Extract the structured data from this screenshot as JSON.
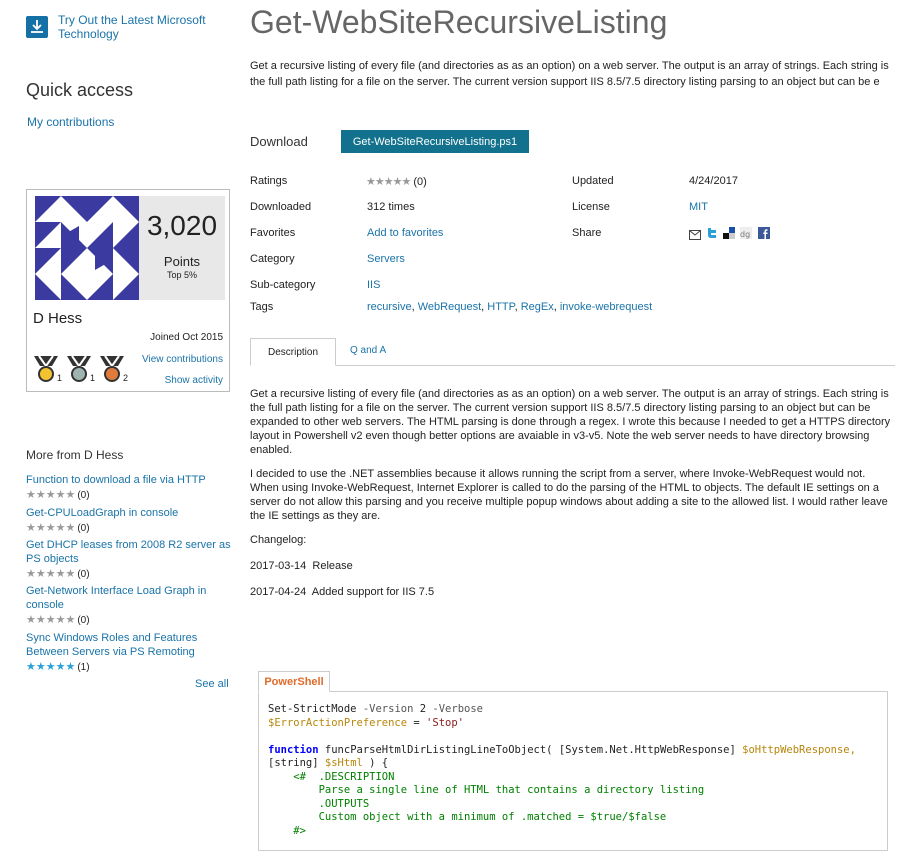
{
  "sidebar": {
    "promo_text": "Try Out the Latest Microsoft Technology",
    "quick_access_title": "Quick access",
    "my_contributions": "My contributions",
    "profile": {
      "points": "3,020",
      "points_label": "Points",
      "rank": "Top 5%",
      "name": "D Hess",
      "joined": "Joined Oct 2015",
      "view_contributions": "View contributions",
      "show_activity": "Show activity",
      "medals": [
        {
          "color": "gold",
          "count": "1"
        },
        {
          "color": "silver",
          "count": "1"
        },
        {
          "color": "bronze",
          "count": "2"
        }
      ]
    },
    "more_title": "More from D Hess",
    "more_items": [
      {
        "title": "Function to download a file via HTTP",
        "stars": "★★★★★",
        "count": "(0)"
      },
      {
        "title": "Get-CPULoadGraph in console",
        "stars": "★★★★★",
        "count": "(0)"
      },
      {
        "title": "Get DHCP leases from 2008 R2 server as PS objects",
        "stars": "★★★★★",
        "count": "(0)"
      },
      {
        "title": "Get-Network Interface Load Graph in console",
        "stars": "★★★★★",
        "count": "(0)"
      },
      {
        "title": "Sync Windows Roles and Features Between Servers via PS Remoting",
        "stars": "★★★★★",
        "count": "(1)"
      }
    ],
    "see_all": "See all"
  },
  "main": {
    "title": "Get-WebSiteRecursiveListing",
    "summary": "Get a recursive listing of every file (and directories as as an option) on a web server. The output is an array of strings. Each string is the full path listing for a file on the server. The current version support IIS 8.5/7.5 directory listing parsing to an object but can be e",
    "download_label": "Download",
    "download_button": "Get-WebSiteRecursiveListing.ps1",
    "meta": {
      "ratings_label": "Ratings",
      "ratings_stars": "★★★★★",
      "ratings_count": "(0)",
      "downloaded_label": "Downloaded",
      "downloaded_value": "312 times",
      "favorites_label": "Favorites",
      "favorites_value": "Add to favorites",
      "category_label": "Category",
      "category_value": "Servers",
      "subcategory_label": "Sub-category",
      "subcategory_value": "IIS",
      "tags_label": "Tags",
      "tags": [
        "recursive",
        "WebRequest",
        "HTTP",
        "RegEx",
        "invoke-webrequest"
      ],
      "updated_label": "Updated",
      "updated_value": "4/24/2017",
      "license_label": "License",
      "license_value": "MIT",
      "share_label": "Share"
    },
    "tabs": [
      "Description",
      "Q and A"
    ],
    "description": [
      "Get a recursive listing of every file (and directories as as an option) on a web server. The output is an array of strings. Each string is the full path listing for a file on the server. The current version support IIS 8.5/7.5 directory listing parsing to an object but can be expanded to other web servers.  The HTML parsing is done through a regex.  I wrote this because I needed to get a HTTPS directory layout in Powershell v2 even though better options are avaiable in v3-v5.  Note the web server needs to have directory browsing enabled.",
      "I decided to use the .NET assemblies because it allows running the script from a server, where Invoke-WebRequest would not.  When using Invoke-WebRequest, Internet Explorer is called to do the parsing of the HTML to objects.  The default IE settings on a server do not allow this parsing and you receive multiple popup windows about adding a site to the allowed list.  I would rather leave the IE settings as they are.",
      "Changelog:",
      "2017-03-14  Release",
      "2017-04-24  Added support for IIS 7.5"
    ],
    "code_tab": "PowerShell",
    "code": {
      "l1_cmd": "Set-StrictMode",
      "l1_p1": "-Version",
      "l1_v1": "2",
      "l1_p2": "-Verbose",
      "l2_var": "$ErrorActionPreference",
      "l2_eq": " = ",
      "l2_str": "'Stop'",
      "l4_kw": "function",
      "l4_name": "funcParseHtmlDirListingLineToObject(",
      "l4_type": "[System.Net.HttpWebResponse]",
      "l4_var": "$oHttpWebResponse,",
      "l5_type": "[string]",
      "l5_var": "$sHtml",
      "l5_rest": " ) {",
      "l6": "<#  .DESCRIPTION",
      "l7": "        Parse a single line of HTML that contains a directory listing",
      "l8": "    .OUTPUTS",
      "l9": "        Custom object with a minimum of .matched = $true/$false",
      "l10": "#>"
    }
  }
}
